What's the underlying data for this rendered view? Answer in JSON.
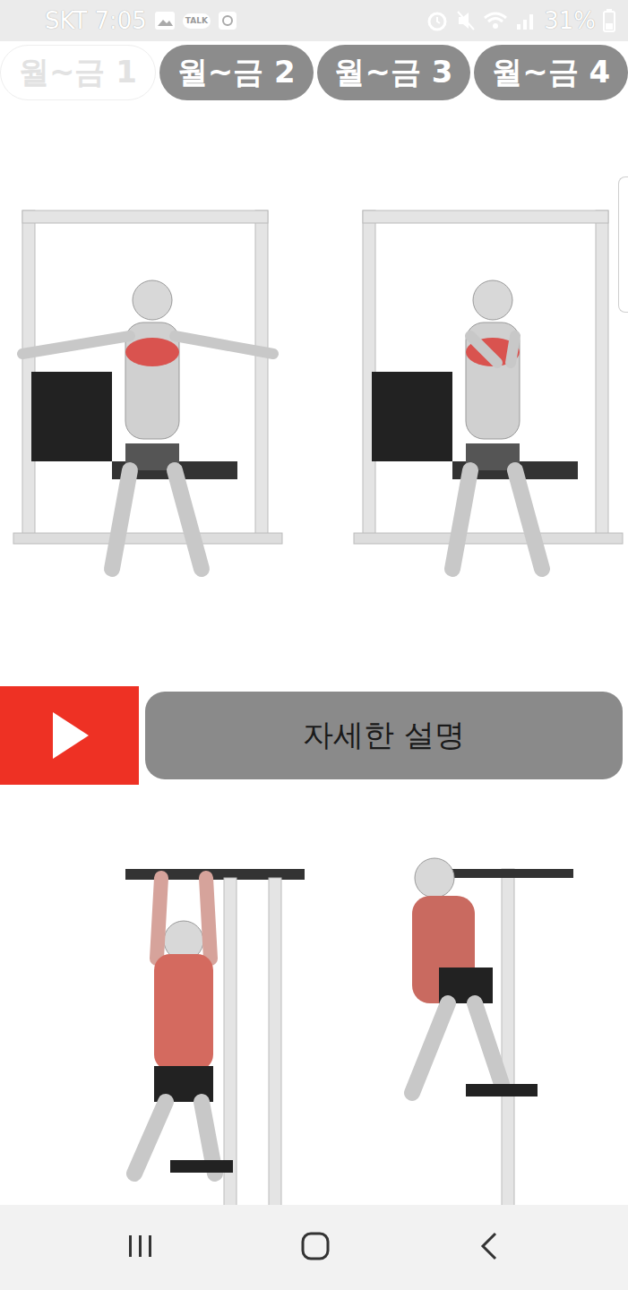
{
  "status_bar": {
    "carrier": "SKT",
    "time": "7:05",
    "talk_badge": "TALK",
    "battery": "31%"
  },
  "tabs": [
    {
      "label": "월~금 1",
      "selected": true
    },
    {
      "label": "월~금 2",
      "selected": false
    },
    {
      "label": "월~금 3",
      "selected": false
    },
    {
      "label": "월~금 4",
      "selected": false
    }
  ],
  "detail_button": {
    "label": "자세한 설명"
  }
}
